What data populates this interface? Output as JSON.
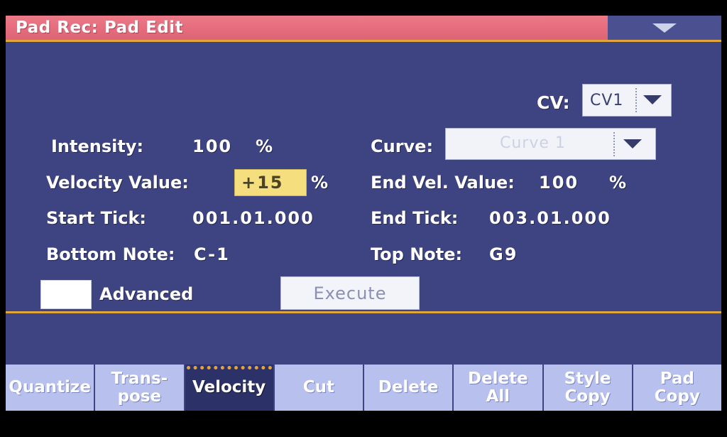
{
  "window": {
    "title": "Pad Rec: Pad Edit",
    "menu_icon": "chevron-down-icon",
    "accent_title_bg": "#e5707f",
    "panel_bg": "#3e4482",
    "divider_color": "#e0a53c"
  },
  "form": {
    "cv": {
      "label": "CV:",
      "value": "CV1",
      "arrow_icon": "triangle-down-icon"
    },
    "intensity": {
      "label": "Intensity:",
      "value": "100",
      "unit": "%"
    },
    "curve": {
      "label": "Curve:",
      "value": "Curve 1",
      "disabled": true,
      "arrow_icon": "triangle-down-icon"
    },
    "velocity_value": {
      "label": "Velocity Value:",
      "value": "+15",
      "unit": "%",
      "highlight_color": "#f5de7e"
    },
    "end_vel_value": {
      "label": "End Vel. Value:",
      "value": "100",
      "unit": "%"
    },
    "start_tick": {
      "label": "Start Tick:",
      "value": "001.01.000"
    },
    "end_tick": {
      "label": "End Tick:",
      "value": "003.01.000"
    },
    "bottom_note": {
      "label": "Bottom Note:",
      "value": "C-1"
    },
    "top_note": {
      "label": "Top Note:",
      "value": "G9"
    },
    "advanced": {
      "label": "Advanced",
      "checked": false
    },
    "execute": {
      "label": "Execute",
      "disabled": true
    }
  },
  "tabs": [
    {
      "label": "Quantize",
      "active": false
    },
    {
      "label": "Trans-\npose",
      "active": false
    },
    {
      "label": "Velocity",
      "active": true
    },
    {
      "label": "Cut",
      "active": false
    },
    {
      "label": "Delete",
      "active": false
    },
    {
      "label": "Delete\nAll",
      "active": false
    },
    {
      "label": "Style\nCopy",
      "active": false
    },
    {
      "label": "Pad\nCopy",
      "active": false
    }
  ]
}
